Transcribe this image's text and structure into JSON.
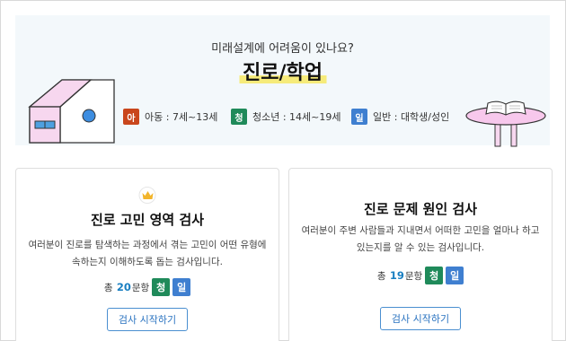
{
  "hero": {
    "subtitle": "미래설계에 어려움이 있나요?",
    "title": "진로/학업",
    "legend": [
      {
        "badge": "아",
        "text": "아동 : 7세~13세",
        "color": "#c9461c"
      },
      {
        "badge": "청",
        "text": "청소년 : 14세~19세",
        "color": "#1f8a5a"
      },
      {
        "badge": "일",
        "text": "일반 : 대학생/성인",
        "color": "#3f7fd0"
      }
    ],
    "highlight_color": "#f6eb7a"
  },
  "cards": [
    {
      "icon": "crown-icon",
      "title": "진로 고민 영역 검사",
      "desc_lines": [
        "여러분이 진로를 탐색하는 과정에서 겪는 고민이 어떤 유형에",
        "속하는지 이해하도록 돕는 검사입니다."
      ],
      "count_prefix": "총",
      "count": "20",
      "count_suffix": "문항",
      "tags": [
        {
          "label": "청",
          "color": "#1f8a5a"
        },
        {
          "label": "일",
          "color": "#3f7fd0"
        }
      ],
      "button": "검사 시작하기"
    },
    {
      "title": "진로 문제 원인 검사",
      "desc_lines": [
        "여러분이 주변 사람들과 지내면서 어떠한 고민을 얼마나 하고",
        "있는지를 알 수 있는 검사입니다."
      ],
      "count_prefix": "총",
      "count": "19",
      "count_suffix": "문항",
      "tags": [
        {
          "label": "청",
          "color": "#1f8a5a"
        },
        {
          "label": "일",
          "color": "#3f7fd0"
        }
      ],
      "button": "검사 시작하기"
    }
  ],
  "colors": {
    "accent": "#2a73c0",
    "count": "#1a7fc1"
  }
}
